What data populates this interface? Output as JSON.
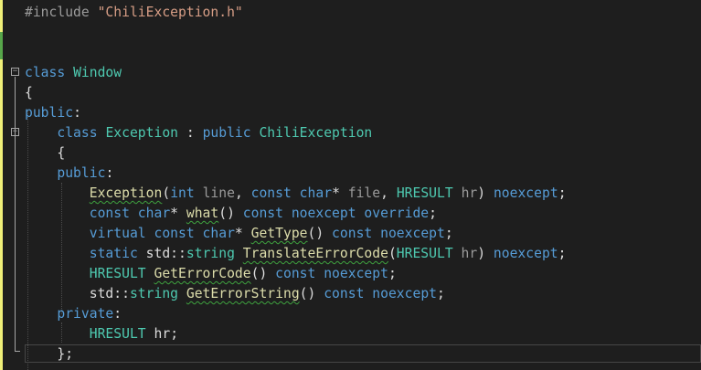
{
  "editor": {
    "lines": [
      {
        "tokens": [
          {
            "t": "#include ",
            "c": "pp"
          },
          {
            "t": "\"ChiliException.h\"",
            "c": "str"
          }
        ]
      },
      {
        "tokens": []
      },
      {
        "tokens": []
      },
      {
        "tokens": [
          {
            "t": "class ",
            "c": "kw"
          },
          {
            "t": "Window",
            "c": "ty"
          }
        ]
      },
      {
        "tokens": [
          {
            "t": "{",
            "c": "plain"
          }
        ]
      },
      {
        "tokens": [
          {
            "t": "public",
            "c": "kw"
          },
          {
            "t": ":",
            "c": "plain"
          }
        ]
      },
      {
        "tokens": [
          {
            "t": "    class ",
            "c": "kw"
          },
          {
            "t": "Exception",
            "c": "ty"
          },
          {
            "t": " : ",
            "c": "plain"
          },
          {
            "t": "public ",
            "c": "kw"
          },
          {
            "t": "ChiliException",
            "c": "ty"
          }
        ]
      },
      {
        "tokens": [
          {
            "t": "    {",
            "c": "plain"
          }
        ]
      },
      {
        "tokens": [
          {
            "t": "    public",
            "c": "kw"
          },
          {
            "t": ":",
            "c": "plain"
          }
        ]
      },
      {
        "tokens": [
          {
            "t": "        ",
            "c": "plain"
          },
          {
            "t": "Exception",
            "c": "fn",
            "squig": true
          },
          {
            "t": "(",
            "c": "plain"
          },
          {
            "t": "int ",
            "c": "kw"
          },
          {
            "t": "line",
            "c": "pa"
          },
          {
            "t": ", ",
            "c": "plain"
          },
          {
            "t": "const char",
            "c": "kw"
          },
          {
            "t": "* ",
            "c": "plain"
          },
          {
            "t": "file",
            "c": "pa"
          },
          {
            "t": ", ",
            "c": "plain"
          },
          {
            "t": "HRESULT ",
            "c": "ty"
          },
          {
            "t": "hr",
            "c": "pa"
          },
          {
            "t": ") ",
            "c": "plain"
          },
          {
            "t": "noexcept",
            "c": "kw"
          },
          {
            "t": ";",
            "c": "plain"
          }
        ]
      },
      {
        "tokens": [
          {
            "t": "        const char",
            "c": "kw"
          },
          {
            "t": "* ",
            "c": "plain"
          },
          {
            "t": "what",
            "c": "fn",
            "squig": true
          },
          {
            "t": "() ",
            "c": "plain"
          },
          {
            "t": "const noexcept override",
            "c": "kw"
          },
          {
            "t": ";",
            "c": "plain"
          }
        ]
      },
      {
        "tokens": [
          {
            "t": "        virtual const char",
            "c": "kw"
          },
          {
            "t": "* ",
            "c": "plain"
          },
          {
            "t": "GetType",
            "c": "fn",
            "squig": true
          },
          {
            "t": "() ",
            "c": "plain"
          },
          {
            "t": "const noexcept",
            "c": "kw"
          },
          {
            "t": ";",
            "c": "plain"
          }
        ]
      },
      {
        "tokens": [
          {
            "t": "        static ",
            "c": "kw"
          },
          {
            "t": "std",
            "c": "plain"
          },
          {
            "t": "::",
            "c": "plain"
          },
          {
            "t": "string ",
            "c": "ty"
          },
          {
            "t": "TranslateErrorCode",
            "c": "fn",
            "squig": true
          },
          {
            "t": "(",
            "c": "plain"
          },
          {
            "t": "HRESULT ",
            "c": "ty"
          },
          {
            "t": "hr",
            "c": "pa"
          },
          {
            "t": ") ",
            "c": "plain"
          },
          {
            "t": "noexcept",
            "c": "kw"
          },
          {
            "t": ";",
            "c": "plain"
          }
        ]
      },
      {
        "tokens": [
          {
            "t": "        ",
            "c": "plain"
          },
          {
            "t": "HRESULT ",
            "c": "ty"
          },
          {
            "t": "GetErrorCode",
            "c": "fn",
            "squig": true
          },
          {
            "t": "() ",
            "c": "plain"
          },
          {
            "t": "const noexcept",
            "c": "kw"
          },
          {
            "t": ";",
            "c": "plain"
          }
        ]
      },
      {
        "tokens": [
          {
            "t": "        std",
            "c": "plain"
          },
          {
            "t": "::",
            "c": "plain"
          },
          {
            "t": "string ",
            "c": "ty"
          },
          {
            "t": "GetErrorString",
            "c": "fn",
            "squig": true
          },
          {
            "t": "() ",
            "c": "plain"
          },
          {
            "t": "const noexcept",
            "c": "kw"
          },
          {
            "t": ";",
            "c": "plain"
          }
        ]
      },
      {
        "tokens": [
          {
            "t": "    private",
            "c": "kw"
          },
          {
            "t": ":",
            "c": "plain"
          }
        ]
      },
      {
        "tokens": [
          {
            "t": "        ",
            "c": "plain"
          },
          {
            "t": "HRESULT ",
            "c": "ty"
          },
          {
            "t": "hr",
            "c": "plain"
          },
          {
            "t": ";",
            "c": "plain"
          }
        ]
      },
      {
        "tokens": [
          {
            "t": "    };",
            "c": "plain"
          }
        ]
      }
    ]
  },
  "colors": {
    "background": "#1e1e1e",
    "keyword": "#569cd6",
    "type": "#4ec9b0",
    "function": "#dcdcaa",
    "string": "#d69d85",
    "preprocessor": "#9b9b9b",
    "text": "#dcdcdc",
    "change_saved": "#57a64a",
    "change_unsaved": "#efef78"
  },
  "icons": [
    "collapse-icon"
  ]
}
